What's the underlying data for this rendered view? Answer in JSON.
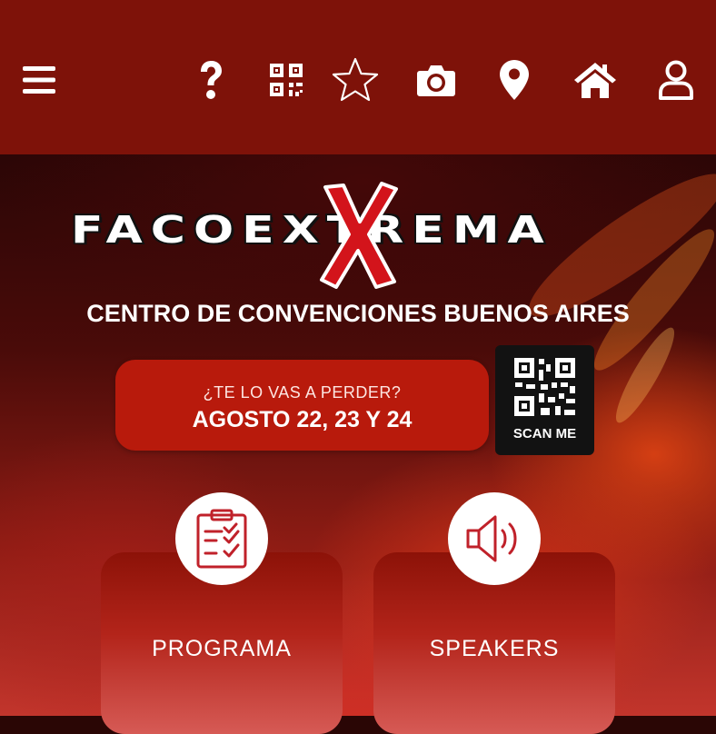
{
  "brand": {
    "wordmark": "FACOEXTREMA",
    "venue": "CENTRO DE CONVENCIONES BUENOS AIRES"
  },
  "event": {
    "question": "¿TE LO VAS A PERDER?",
    "dates": "AGOSTO 22, 23 Y 24"
  },
  "qr": {
    "label": "SCAN ME"
  },
  "toolbar": {
    "icons": [
      "menu-icon",
      "help-icon",
      "qr-code-icon",
      "star-icon",
      "camera-icon",
      "location-pin-icon",
      "home-icon",
      "user-icon"
    ]
  },
  "cards": [
    {
      "label": "PROGRAMA",
      "icon": "clipboard-checklist-icon"
    },
    {
      "label": "SPEAKERS",
      "icon": "speaker-volume-icon"
    }
  ],
  "colors": {
    "topbar": "#7e1209",
    "pill": "#b81a0c",
    "accent_red": "#d3141b"
  }
}
